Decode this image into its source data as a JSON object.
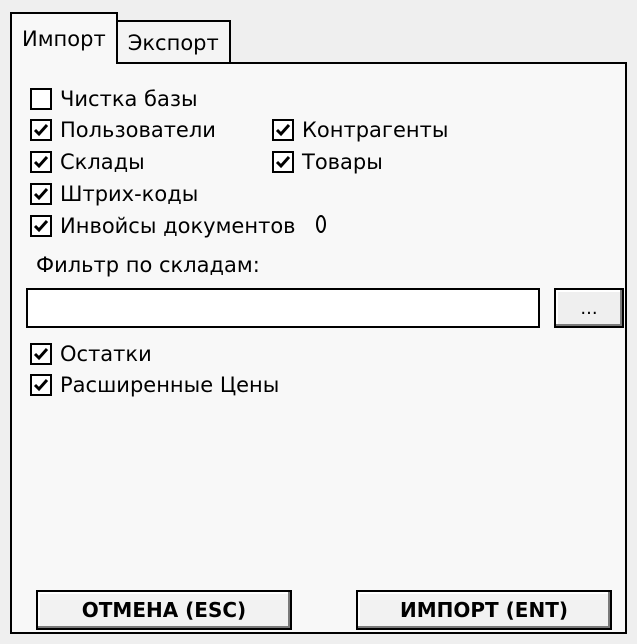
{
  "tabs": [
    {
      "label": "Импорт",
      "active": true
    },
    {
      "label": "Экспорт",
      "active": false
    }
  ],
  "options": {
    "clean_db": {
      "label": "Чистка базы",
      "checked": false
    },
    "users": {
      "label": "Пользователи",
      "checked": true
    },
    "contractors": {
      "label": "Контрагенты",
      "checked": true
    },
    "warehouses": {
      "label": "Склады",
      "checked": true
    },
    "goods": {
      "label": "Товары",
      "checked": true
    },
    "barcodes": {
      "label": "Штрих-коды",
      "checked": true
    },
    "invoices": {
      "label": "Инвойсы документов",
      "checked": true
    },
    "stock": {
      "label": "Остатки",
      "checked": true
    },
    "extended_prices": {
      "label": "Расширенные Цены",
      "checked": true
    }
  },
  "filter": {
    "label": "Фильтр по складам:",
    "value": "",
    "browse_label": "..."
  },
  "buttons": {
    "cancel_label": "ОТМЕНА (ESC)",
    "import_label": "ИМПОРТ (ENT)"
  }
}
